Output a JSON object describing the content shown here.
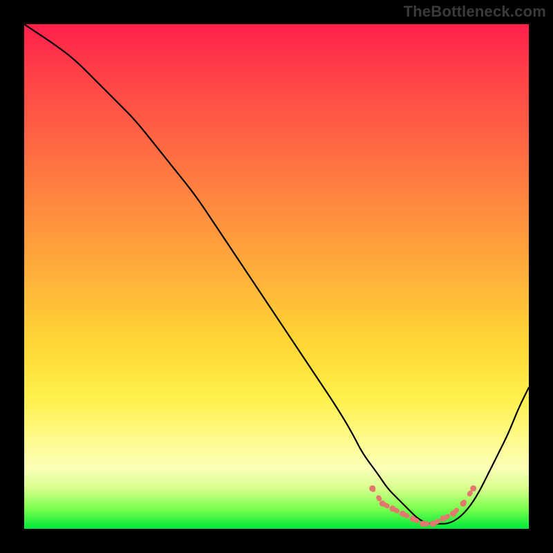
{
  "watermark": "TheBottleneck.com",
  "chart_data": {
    "type": "line",
    "title": "",
    "xlabel": "",
    "ylabel": "",
    "xlim": [
      0,
      100
    ],
    "ylim": [
      0,
      100
    ],
    "series": [
      {
        "name": "bottleneck-curve",
        "color": "#000000",
        "x": [
          0,
          3,
          6,
          10,
          14,
          18,
          22,
          26,
          30,
          34,
          38,
          42,
          46,
          50,
          54,
          58,
          62,
          65,
          67,
          70,
          72,
          74,
          76,
          78,
          80,
          82,
          84,
          86,
          88,
          90,
          92,
          94,
          96,
          98,
          100
        ],
        "y": [
          100,
          98,
          96,
          93,
          89,
          85,
          81,
          76,
          71,
          66,
          60,
          54,
          48,
          42,
          36,
          30,
          24,
          19,
          15,
          11,
          8,
          6,
          4,
          2,
          1,
          1,
          1,
          2,
          4,
          7,
          11,
          15,
          19,
          24,
          28
        ]
      }
    ],
    "markers": {
      "name": "valley-dots",
      "color": "#e4776e",
      "x": [
        69,
        71,
        73,
        75,
        77,
        79,
        81,
        83,
        85,
        87,
        89
      ],
      "y": [
        8,
        5,
        4,
        3,
        2,
        1,
        1,
        2,
        3,
        5,
        8
      ]
    },
    "gradient_stops": [
      {
        "pos": 0.0,
        "color": "#ff1f4a"
      },
      {
        "pos": 0.5,
        "color": "#ffb13a"
      },
      {
        "pos": 0.8,
        "color": "#fff04a"
      },
      {
        "pos": 1.0,
        "color": "#00e83a"
      }
    ]
  }
}
